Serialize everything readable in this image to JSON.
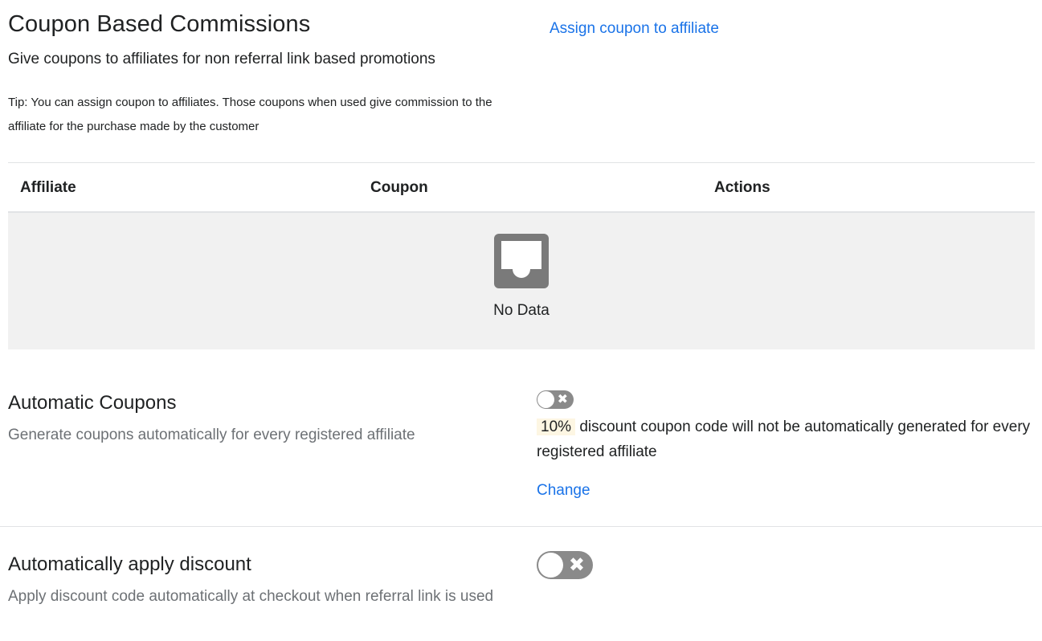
{
  "header": {
    "title": "Coupon Based Commissions",
    "subtitle": "Give coupons to affiliates for non referral link based promotions",
    "tip": "Tip: You can assign coupon to affiliates. Those coupons when used give commission to the affiliate for the purchase made by the customer",
    "assign_link": "Assign coupon to affiliate"
  },
  "table": {
    "columns": [
      "Affiliate",
      "Coupon",
      "Actions"
    ],
    "rows": [],
    "empty_text": "No Data"
  },
  "automatic_coupons": {
    "title": "Automatic Coupons",
    "description": "Generate coupons automatically for every registered affiliate",
    "enabled": false,
    "discount": "10%",
    "status_text": "discount coupon code will not be automatically generated for every registered affiliate",
    "change_link": "Change"
  },
  "auto_apply": {
    "title": "Automatically apply discount",
    "description": "Apply discount code automatically at checkout when referral link is used",
    "enabled": false
  },
  "icons": {
    "empty": "inbox-icon",
    "toggle_off": "close-icon"
  },
  "colors": {
    "link": "#1a73e8",
    "toggle_off": "#8a8a8a",
    "empty_bg": "#f1f1f1",
    "badge_bg": "#fdf6e3"
  }
}
